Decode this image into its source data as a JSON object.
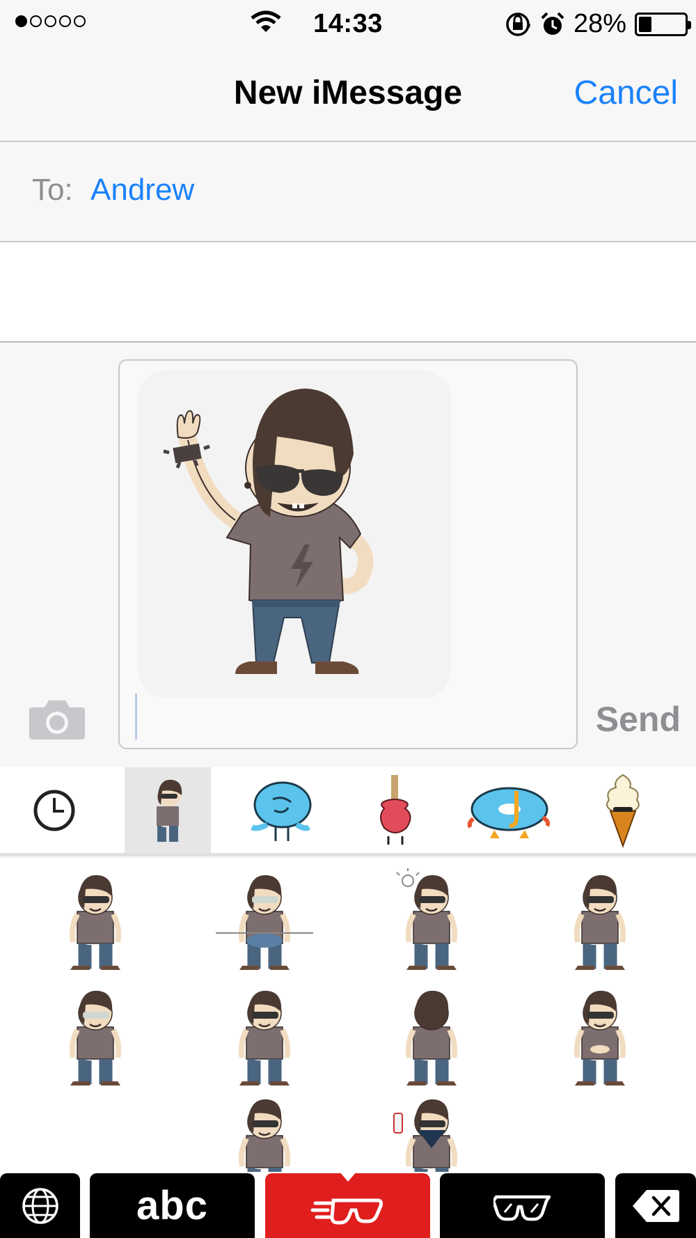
{
  "status_bar": {
    "signal_dots": 5,
    "signal_filled": 1,
    "time": "14:33",
    "battery_percent": "28%",
    "battery_level": 0.28,
    "icons": [
      "wifi-icon",
      "rotation-lock-icon",
      "alarm-icon",
      "battery-icon"
    ]
  },
  "nav": {
    "title": "New iMessage",
    "cancel_label": "Cancel"
  },
  "to_field": {
    "label": "To:",
    "recipient": "Andrew"
  },
  "compose": {
    "attachment": "rocker-boy-waving-sticker",
    "send_label": "Send",
    "camera_icon": "camera-icon"
  },
  "sticker_tabs": [
    {
      "icon": "recent-clock-icon",
      "active": false
    },
    {
      "icon": "rocker-boy-pack-icon",
      "active": true
    },
    {
      "icon": "blue-blob-pack-icon",
      "active": false
    },
    {
      "icon": "guitar-pack-icon",
      "active": false
    },
    {
      "icon": "snorkel-donut-pack-icon",
      "active": false
    },
    {
      "icon": "ice-cream-pack-icon",
      "active": false
    }
  ],
  "stickers": [
    "rocker-blinking",
    "rocker-with-pan",
    "rocker-with-lightbulb",
    "rocker-grinning",
    "rocker-arms-crossed-monocle",
    "rocker-mustache",
    "rocker-back-view",
    "rocker-belly",
    "rocker-middle-finger",
    "rocker-bandana-spray"
  ],
  "keyboard_bar": {
    "globe_icon": "globe-icon",
    "abc_label": "abc",
    "active_key": "sticker-keyboard-icon",
    "glasses_icon": "sunglasses-icon",
    "delete_icon": "backspace-icon"
  },
  "colors": {
    "accent": "#1a82fb",
    "keyboard_active": "#e11e1e",
    "shirt": "#7d6e6f",
    "hair": "#4a3a32",
    "skin": "#f1dcc0"
  }
}
